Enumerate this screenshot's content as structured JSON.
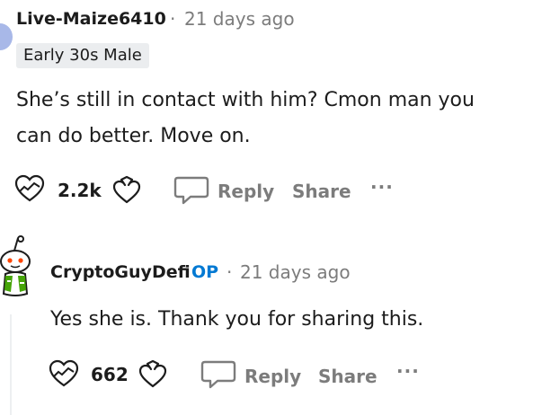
{
  "comment1": {
    "username": "Live-Maize6410",
    "separator": "·",
    "timestamp": "21 days ago",
    "flair": "Early 30s Male",
    "body_lines": [
      "She’s still in contact with him? Cmon man you",
      "can do better. Move on."
    ],
    "upvotes": "2.2k",
    "reply_label": "Reply",
    "share_label": "Share",
    "more_label": "···"
  },
  "comment2": {
    "username": "CryptoGuyDefi",
    "op_badge": "OP",
    "separator": "·",
    "timestamp": "21 days ago",
    "body": "Yes she is. Thank you for sharing this.",
    "upvotes": "662",
    "reply_label": "Reply",
    "share_label": "Share",
    "more_label": "···"
  },
  "colors": {
    "text": "#1c1c1c",
    "meta": "#7c7c7c",
    "op": "#0079d3",
    "flair_bg": "#ebedef",
    "avatar_accent": "#ff4500"
  }
}
